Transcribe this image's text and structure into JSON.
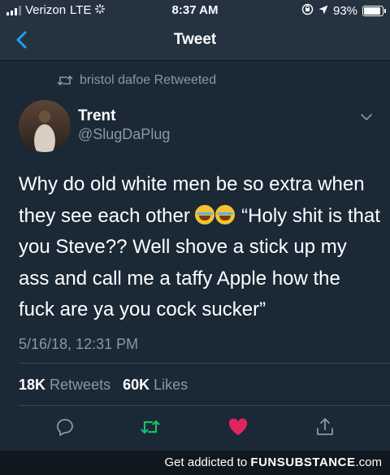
{
  "status_bar": {
    "carrier": "Verizon",
    "network": "LTE",
    "time": "8:37 AM",
    "battery": "93%"
  },
  "nav": {
    "title": "Tweet"
  },
  "tweet": {
    "retweeted_by": "bristol dafoe Retweeted",
    "author_name": "Trent",
    "author_handle": "@SlugDaPlug",
    "text_part1": "Why do old white men be so extra when they see each other ",
    "text_part2": " “Holy shit is that you Steve?? Well shove a stick up my ass and call me a taffy Apple how the fuck are ya you cock sucker”",
    "emoji": "face-with-tears-of-joy-emoji",
    "timestamp": "5/16/18, 12:31 PM",
    "retweets_count": "18K",
    "retweets_label": "Retweets",
    "likes_count": "60K",
    "likes_label": "Likes"
  },
  "colors": {
    "background": "#1b2836",
    "nav_background": "#253341",
    "accent": "#1da1f2",
    "muted_text": "#8899a6",
    "retweet_green": "#17bf63",
    "like_red": "#e0245e"
  },
  "actions": [
    "reply-icon",
    "retweet-icon",
    "like-icon",
    "share-icon"
  ],
  "footer": {
    "prefix": "Get addicted to ",
    "brand": "FUNSUBSTANCE",
    "suffix": ".com"
  }
}
